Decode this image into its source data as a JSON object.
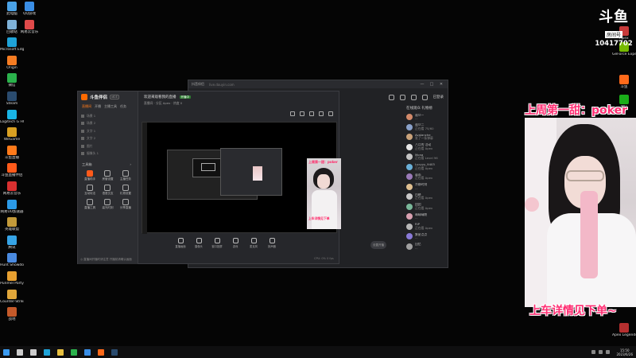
{
  "desktop": {
    "left_icons": [
      {
        "label": "此电脑",
        "color": "#4aa3e8"
      },
      {
        "label": "回收站",
        "color": "#7fb2d8"
      },
      {
        "label": "Microsoft Edge",
        "color": "#1fa3d8"
      },
      {
        "label": "Origin",
        "color": "#f57c22"
      },
      {
        "label": "微信",
        "color": "#2bb24c"
      },
      {
        "label": "Steam",
        "color": "#2a4b6e"
      },
      {
        "label": "Logitech G HUB",
        "color": "#19b5e5"
      },
      {
        "label": "WeGame",
        "color": "#d9a022"
      },
      {
        "label": "斗鱼直播",
        "color": "#ff7a1a"
      },
      {
        "label": "斗鱼直播伴侣",
        "color": "#ff5a1a"
      },
      {
        "label": "网易云音乐",
        "color": "#d93030"
      },
      {
        "label": "网易UU加速器",
        "color": "#2b9ae8"
      },
      {
        "label": "英雄联盟",
        "color": "#c39a3a"
      },
      {
        "label": "腾讯",
        "color": "#36a4e6"
      },
      {
        "label": "Hunt Showdown",
        "color": "#4a8ae0"
      },
      {
        "label": "Punmel Party",
        "color": "#e8a030"
      },
      {
        "label": "Counter-Strike 2",
        "color": "#e0a63a"
      },
      {
        "label": "战地",
        "color": "#c55a2a"
      }
    ],
    "left_icons_col2": [
      {
        "label": "QQ游戏",
        "color": "#3a8ee6"
      },
      {
        "label": "网易云音乐",
        "color": "#e04a4a"
      }
    ],
    "right_icons": [
      {
        "label": "Apex",
        "color": "#c83a3a"
      },
      {
        "label": "GeForce Experience",
        "color": "#76b900"
      },
      {
        "label": "斗鱼",
        "color": "#ff6a1a"
      },
      {
        "label": "微信",
        "color": "#1aad19"
      },
      {
        "label": "直播",
        "color": "#e8e8e8"
      },
      {
        "label": "Apex Legends",
        "color": "#b52f2f"
      }
    ]
  },
  "back_window": {
    "title": "抖音伴侣",
    "url": "live.douyin.com",
    "controls": [
      "—",
      "□",
      "✕"
    ],
    "login_text": "已登录",
    "chat_header": "在线观众  礼物榜",
    "chat_rows": [
      {
        "name": "观众一",
        "msg": "...",
        "color": "#d38a6a"
      },
      {
        "name": "观众二",
        "msg": "正在看 75/60",
        "color": "#8aa1c9"
      },
      {
        "name": "Avalanche",
        "msg": "发了一条弹幕",
        "color": "#c9a27a"
      },
      {
        "name": "八月的 活动",
        "msg": "正在看 Apex",
        "color": "#e8e8e8"
      },
      {
        "name": "Mona",
        "msg": "正在看 Level 96",
        "color": "#c4c4c4"
      },
      {
        "name": "Lucyyy_9403",
        "msg": "正在看 Apex",
        "color": "#6ab0d8"
      },
      {
        "name": "暮雨",
        "msg": "正在看 Apex",
        "color": "#9a7ab8"
      },
      {
        "name": "冷静时刻",
        "msg": "...",
        "color": "#e0c090"
      },
      {
        "name": "白晓",
        "msg": "正在看 Apex",
        "color": "#c9c9c9"
      },
      {
        "name": "团团",
        "msg": "正在看 Apex",
        "color": "#7ab89a"
      },
      {
        "name": "晴晴晴朗",
        "msg": "...",
        "color": "#d8a0b0"
      },
      {
        "name": "RIP",
        "msg": "正在看 Apex",
        "color": "#b8b8b8"
      },
      {
        "name": "繁星点点",
        "msg": "...",
        "color": "#8a7ad8"
      },
      {
        "name": "回忆",
        "msg": "...",
        "color": "#a0a0a0"
      }
    ]
  },
  "front_window": {
    "app_name": "斗鱼伴侣",
    "version": "v6.6",
    "tabs": [
      "直播间",
      "开播",
      "主播工具",
      "任务"
    ],
    "active_tab": 0,
    "scenes": [
      "场景 1",
      "场景 2",
      "文字 1",
      "文字 2",
      "图片",
      "摄像头 1"
    ],
    "tools_label": "工具箱",
    "tools_more": "›",
    "tools": [
      {
        "label": "直播助手",
        "hot": true
      },
      {
        "label": "房管设置",
        "hot": false
      },
      {
        "label": "主播任务",
        "hot": false
      },
      {
        "label": "互动玩法",
        "hot": false
      },
      {
        "label": "语音交友",
        "hot": false
      },
      {
        "label": "礼物设置",
        "hot": false
      },
      {
        "label": "直播工具",
        "hot": false
      },
      {
        "label": "高光时刻",
        "hot": false
      },
      {
        "label": "分享直播",
        "hot": false
      }
    ],
    "footer": "◎ 直播间开播时请注意 开播前请确认画面",
    "stream_title": "欢迎来观看我的直播",
    "badge": "开播中",
    "stream_meta": "直播间 · 分区 Apex · 热度 0",
    "bottom_tools": [
      "直播画面",
      "摄像头",
      "窗口投屏",
      "游戏",
      "麦克风",
      "扬声器"
    ],
    "go_button": "设置开播",
    "status": "CPU: 0%  0 fps",
    "preview_caption_top": "上周第一甜：poker",
    "preview_caption_bottom": "上车详情见下单"
  },
  "overlay": {
    "logo_main": "斗鱼",
    "logo_sub": "房间号",
    "room_number": "10417702",
    "caption_top": "上周第一甜：poker",
    "caption_bottom": "上车详情见下单~"
  },
  "taskbar": {
    "icons": [
      {
        "name": "windows",
        "color": "#3a9af0"
      },
      {
        "name": "search",
        "color": "#ccc"
      },
      {
        "name": "task-view",
        "color": "#ccc"
      },
      {
        "name": "edge",
        "color": "#1fa3d8"
      },
      {
        "name": "explorer",
        "color": "#e8c040"
      },
      {
        "name": "wechat",
        "color": "#2bb24c"
      },
      {
        "name": "qq",
        "color": "#3a8ee6"
      },
      {
        "name": "douyu",
        "color": "#ff6a1a"
      },
      {
        "name": "steam",
        "color": "#2a4b6e"
      }
    ],
    "time": "15:50",
    "date": "2023/6/26"
  }
}
